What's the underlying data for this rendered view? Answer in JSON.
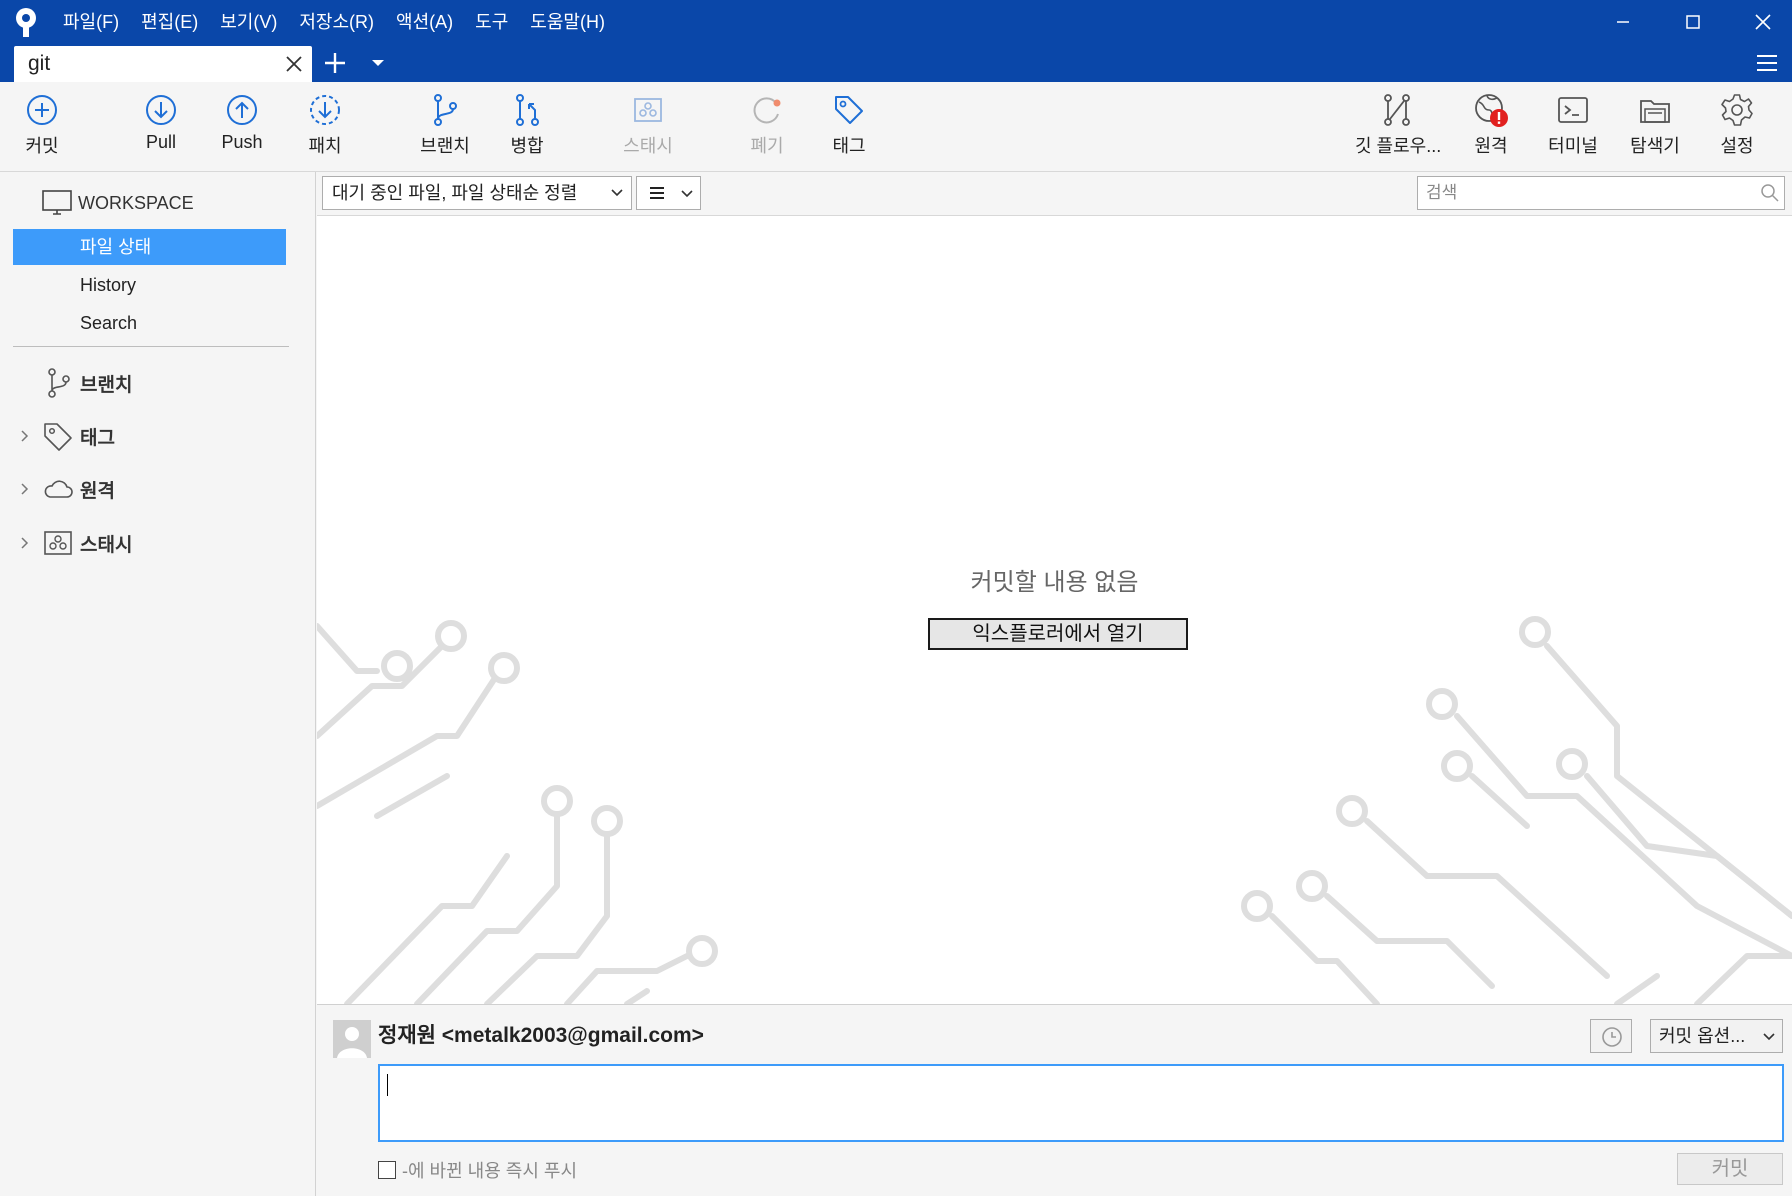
{
  "menu": [
    "파일(F)",
    "편집(E)",
    "보기(V)",
    "저장소(R)",
    "액션(A)",
    "도구",
    "도움말(H)"
  ],
  "tab": {
    "label": "git"
  },
  "toolbar": {
    "commit": "커밋",
    "pull": "Pull",
    "push": "Push",
    "fetch": "패치",
    "branch": "브랜치",
    "merge": "병합",
    "stash": "스태시",
    "discard": "폐기",
    "tag": "태그",
    "gitflow": "깃 플로우...",
    "remote": "원격",
    "terminal": "터미널",
    "explorer": "탐색기",
    "settings": "설정"
  },
  "sidebar": {
    "workspace": "WORKSPACE",
    "items": [
      "파일 상태",
      "History",
      "Search"
    ],
    "sections": [
      "브랜치",
      "태그",
      "원격",
      "스태시"
    ]
  },
  "filter": {
    "selected": "대기 중인 파일, 파일 상태순 정렬",
    "search_placeholder": "검색"
  },
  "content": {
    "empty_message": "커밋할 내용 없음",
    "open_explorer": "익스플로러에서 열기"
  },
  "commit": {
    "author": "정재원 <metalk2003@gmail.com>",
    "options": "커밋 옵션...",
    "push_label": "-에 바뀐 내용 즉시 푸시",
    "button": "커밋"
  },
  "colors": {
    "titlebar": "#0a47a9",
    "accent": "#3d9bfa",
    "icon_blue": "#1f6fd6",
    "alert": "#e1201f"
  }
}
